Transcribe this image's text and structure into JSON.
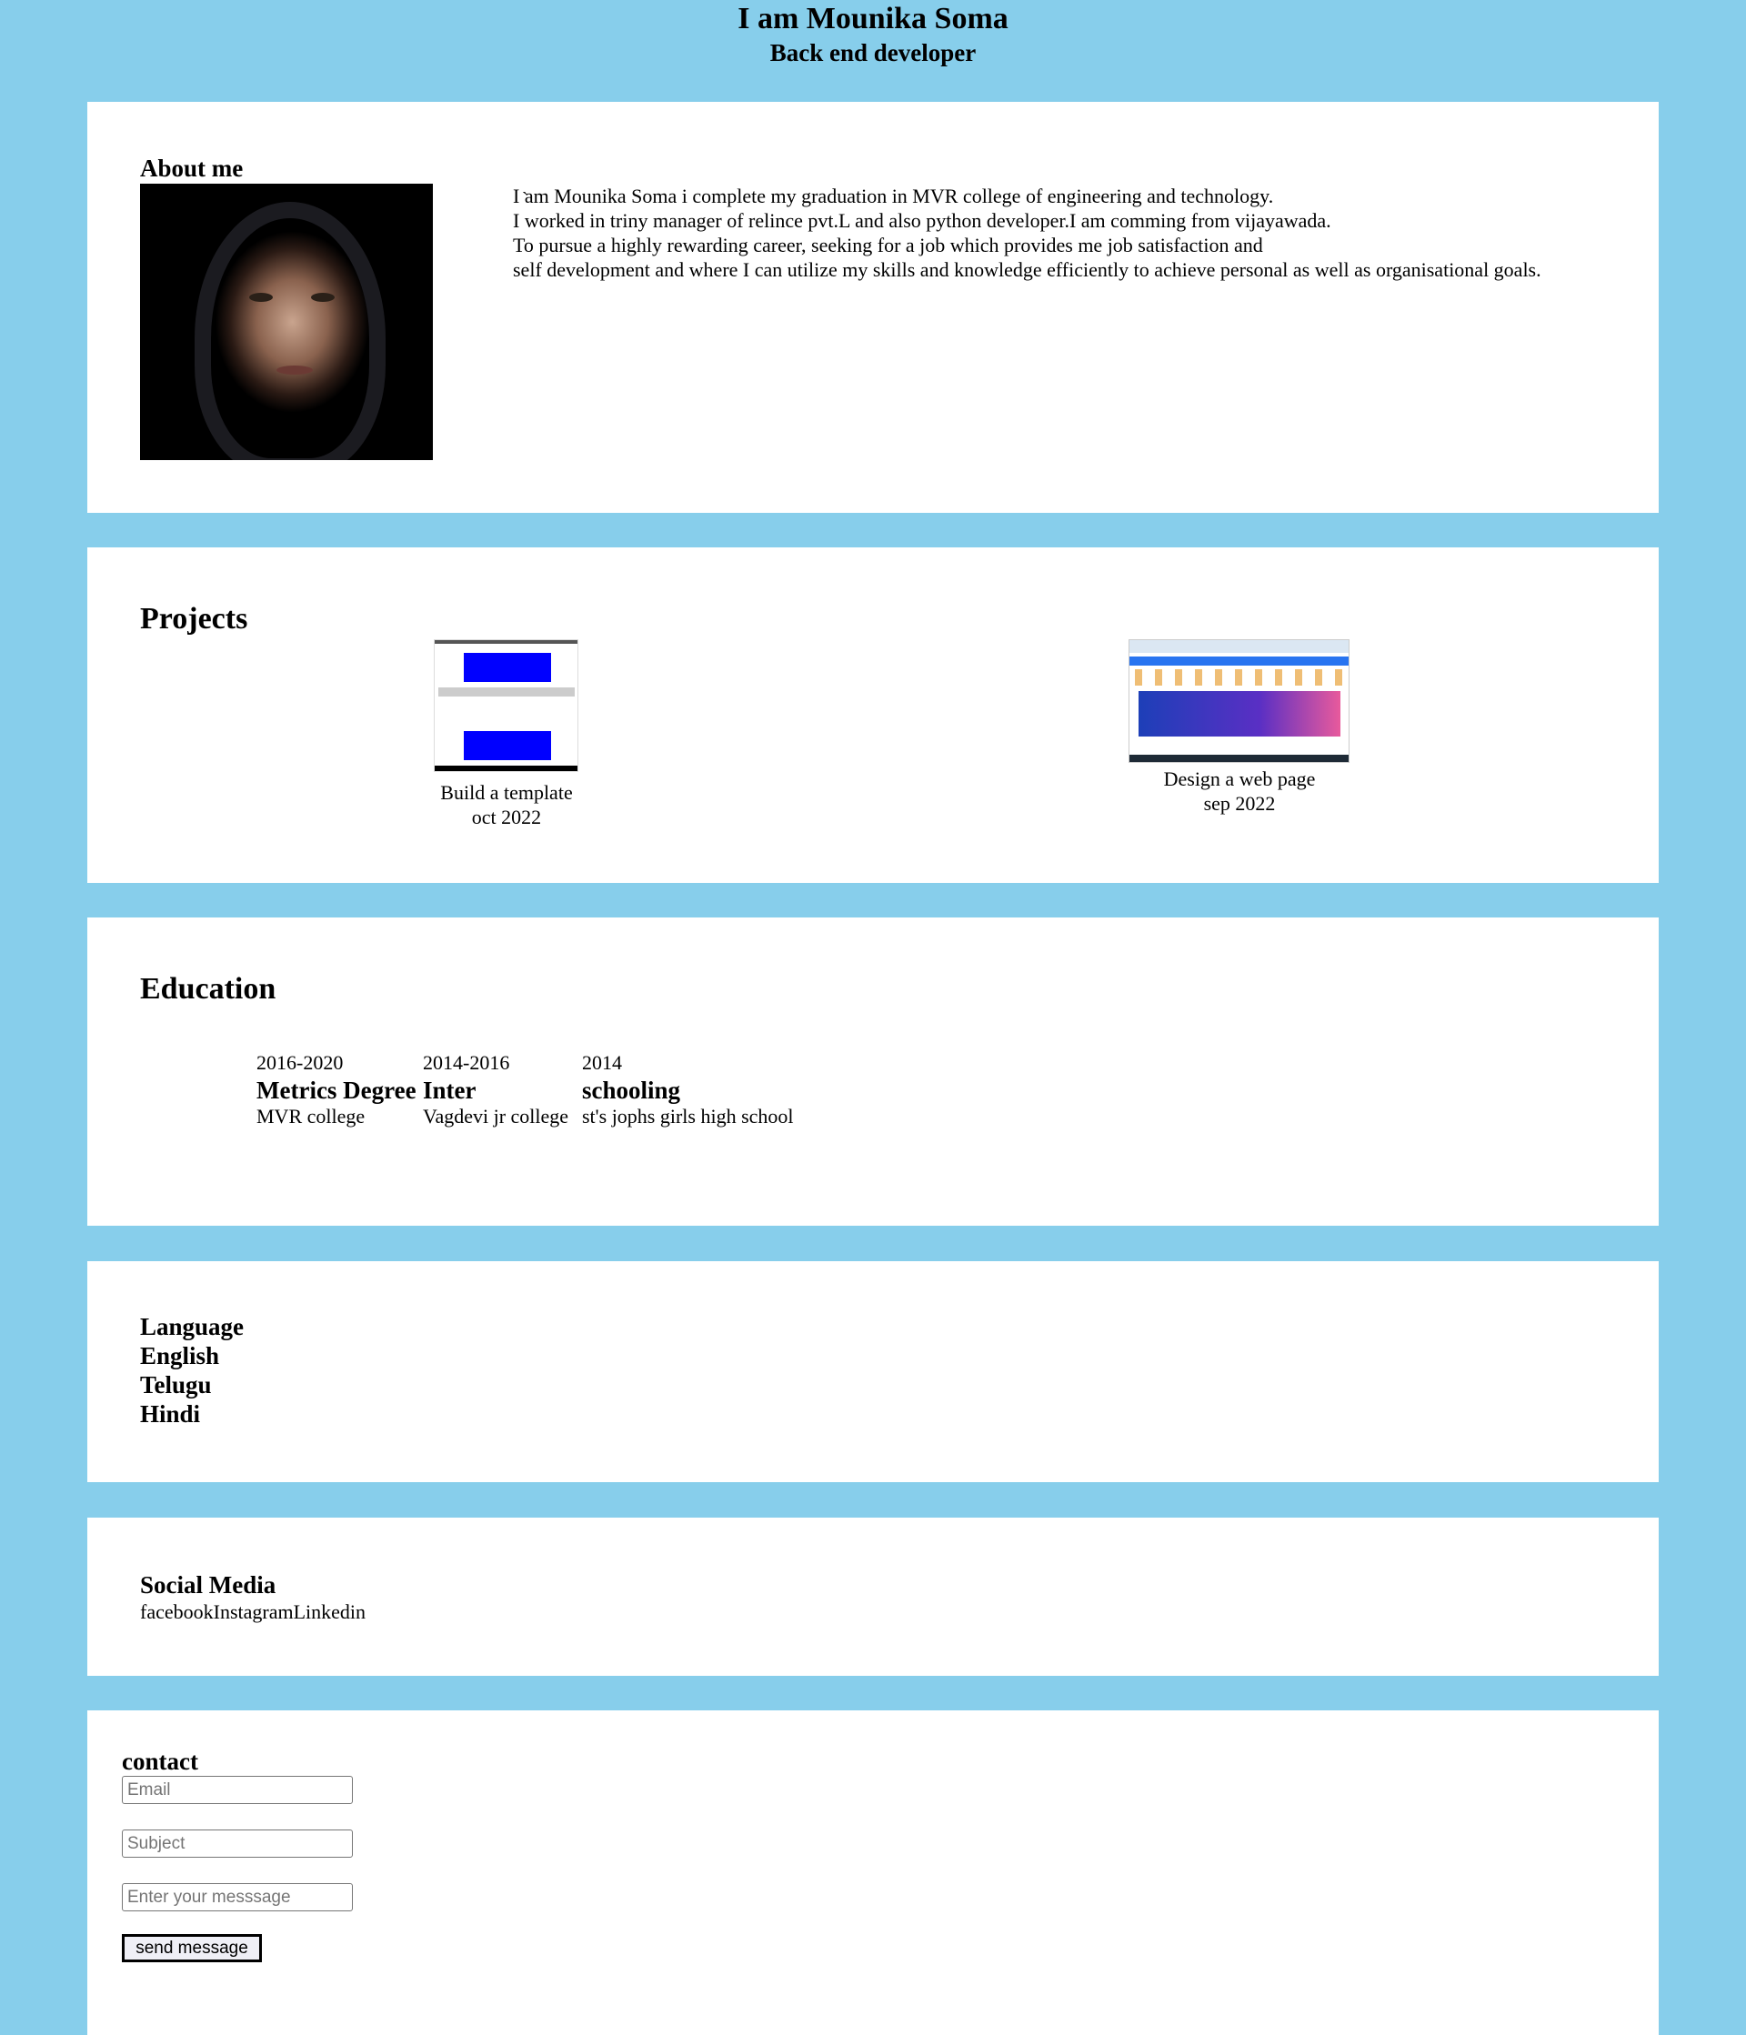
{
  "header": {
    "title": "I am Mounika Soma",
    "subtitle": "Back end developer"
  },
  "about": {
    "heading": "About me",
    "image_icon": "portrait-photo",
    "tick": "`",
    "lines": [
      "I am Mounika Soma i complete my graduation in MVR college of engineering and technology.",
      "I worked in triny manager of relince pvt.L and also python developer.I am comming from vijayawada.",
      "To pursue a highly rewarding career, seeking for a job which provides me job satisfaction and",
      "self development and where I can utilize my skills and knowledge efficiently to achieve personal as well as organisational goals."
    ]
  },
  "projects": {
    "heading": "Projects",
    "items": [
      {
        "title": "Build a template",
        "date": "oct 2022"
      },
      {
        "title": "Design a web page",
        "date": "sep 2022"
      }
    ]
  },
  "education": {
    "heading": "Education",
    "items": [
      {
        "year": "2016-2020",
        "degree": "Metrics Degree",
        "institution": "MVR college"
      },
      {
        "year": "2014-2016",
        "degree": "Inter",
        "institution": "Vagdevi jr college"
      },
      {
        "year": "2014",
        "degree": "schooling",
        "institution": "st's jophs girls high school"
      }
    ]
  },
  "language": {
    "heading": "Language",
    "items": [
      "English",
      "Telugu",
      "Hindi"
    ]
  },
  "social": {
    "heading": "Social Media",
    "links": [
      "facebook",
      "Instagram",
      "Linkedin"
    ]
  },
  "contact": {
    "heading": "contact",
    "email_placeholder": "Email",
    "subject_placeholder": "Subject",
    "message_placeholder": "Enter your messsage",
    "button_label": "send message"
  },
  "colors": {
    "background": "#87CEEB",
    "panel": "#FFFFFF"
  }
}
